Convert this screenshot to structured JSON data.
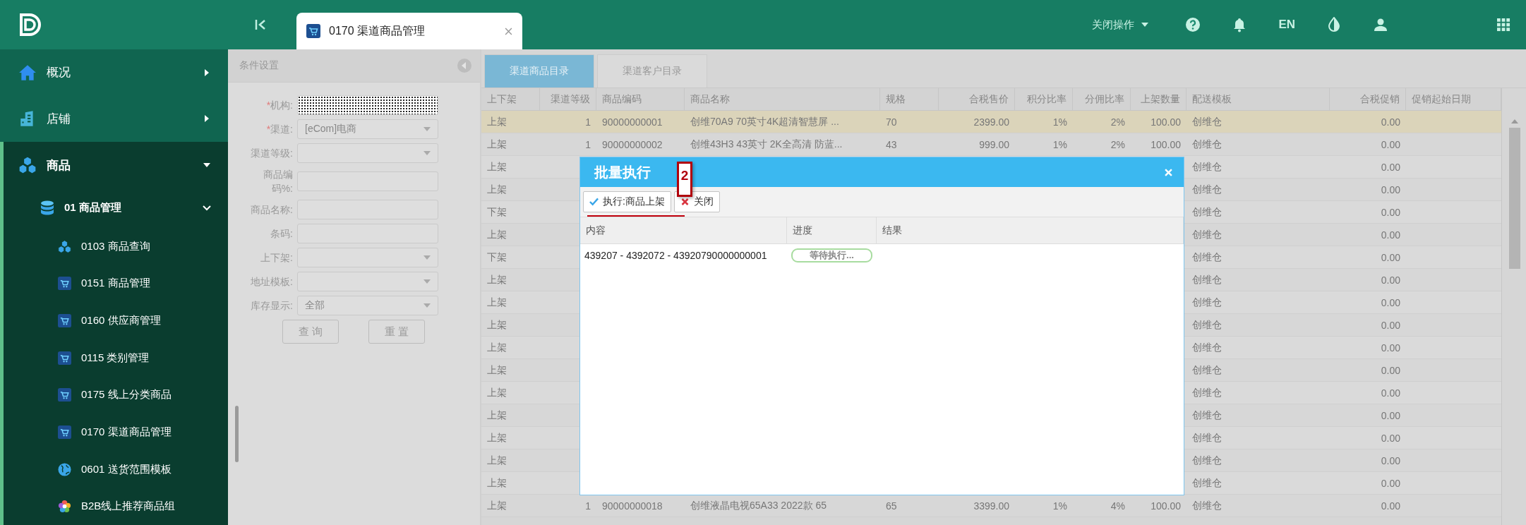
{
  "topbar": {
    "tab": {
      "label": "0170 渠道商品管理",
      "selected": true
    },
    "close_ops": "关闭操作",
    "language": "EN"
  },
  "sidebar": {
    "items": [
      {
        "label": "概况",
        "expanded": false
      },
      {
        "label": "店铺",
        "expanded": false
      },
      {
        "label": "商品",
        "expanded": true,
        "children": [
          {
            "label": "01 商品管理",
            "expanded": true,
            "children": [
              {
                "label": "0103 商品查询"
              },
              {
                "label": "0151 商品管理"
              },
              {
                "label": "0160 供应商管理"
              },
              {
                "label": "0115 类别管理"
              },
              {
                "label": "0175 线上分类商品"
              },
              {
                "label": "0170 渠道商品管理"
              },
              {
                "label": "0601 送货范围模板"
              },
              {
                "label": "B2B线上推荐商品组"
              }
            ]
          }
        ]
      }
    ]
  },
  "filter_panel": {
    "title": "条件设置",
    "fields": [
      {
        "label": "机构:",
        "required_mark": "*",
        "kind": "masked"
      },
      {
        "label": "渠道:",
        "required_mark": "*",
        "kind": "select",
        "value": "[eCom]电商"
      },
      {
        "label": "渠道等级:",
        "kind": "select"
      },
      {
        "label": "商品编码%:",
        "kind": "input"
      },
      {
        "label": "商品名称:",
        "kind": "input"
      },
      {
        "label": "条码:",
        "kind": "input"
      },
      {
        "label": "上下架:",
        "kind": "select"
      },
      {
        "label": "地址模板:",
        "kind": "select"
      },
      {
        "label": "库存显示:",
        "kind": "select",
        "value": "全部"
      }
    ],
    "buttons": [
      "查 询",
      "重 置"
    ]
  },
  "tabs": [
    {
      "label": "渠道商品目录",
      "selected": true
    },
    {
      "label": "渠道客户目录",
      "selected": false
    }
  ],
  "table": {
    "columns": [
      "上下架",
      "渠道等级",
      "商品编码",
      "商品名称",
      "规格",
      "合税售价",
      "积分比率",
      "分佣比率",
      "上架数量",
      "配送模板",
      "合税促销",
      "促销起始日期"
    ],
    "rows": [
      {
        "selected": true,
        "cells": [
          "上架",
          "1",
          "90000000001",
          "创维70A9 70英寸4K超清智慧屏 ...",
          "70",
          "2399.00",
          "1%",
          "2%",
          "100.00",
          "创维仓",
          "0.00"
        ]
      },
      {
        "selected": false,
        "cells": [
          "上架",
          "1",
          "90000000002",
          "创维43H3 43英寸 2K全高清 防蓝...",
          "43",
          "999.00",
          "1%",
          "2%",
          "100.00",
          "创维仓",
          "0.00"
        ]
      },
      {
        "selected": false,
        "cells": [
          "上架",
          null,
          null,
          null,
          null,
          null,
          null,
          null,
          null,
          "创维仓",
          "0.00"
        ]
      },
      {
        "selected": false,
        "cells": [
          "上架",
          null,
          null,
          null,
          null,
          null,
          null,
          null,
          null,
          "创维仓",
          "0.00"
        ]
      },
      {
        "selected": false,
        "cells": [
          "下架",
          null,
          null,
          null,
          null,
          null,
          null,
          null,
          null,
          "创维仓",
          "0.00"
        ]
      },
      {
        "selected": false,
        "cells": [
          "上架",
          null,
          null,
          null,
          null,
          null,
          null,
          null,
          null,
          "创维仓",
          "0.00"
        ]
      },
      {
        "selected": false,
        "cells": [
          "下架",
          null,
          null,
          null,
          null,
          null,
          null,
          null,
          null,
          "创维仓",
          "0.00"
        ]
      },
      {
        "selected": false,
        "cells": [
          "上架",
          null,
          null,
          null,
          null,
          null,
          null,
          null,
          null,
          "创维仓",
          "0.00"
        ]
      },
      {
        "selected": false,
        "cells": [
          "上架",
          null,
          null,
          null,
          null,
          null,
          null,
          null,
          null,
          "创维仓",
          "0.00"
        ]
      },
      {
        "selected": false,
        "cells": [
          "上架",
          null,
          null,
          null,
          null,
          null,
          null,
          null,
          null,
          "创维仓",
          "0.00"
        ]
      },
      {
        "selected": false,
        "cells": [
          "上架",
          null,
          null,
          null,
          null,
          null,
          null,
          null,
          null,
          "创维仓",
          "0.00"
        ]
      },
      {
        "selected": false,
        "cells": [
          "上架",
          null,
          null,
          null,
          null,
          null,
          null,
          null,
          null,
          "创维仓",
          "0.00"
        ]
      },
      {
        "selected": false,
        "cells": [
          "上架",
          null,
          null,
          null,
          null,
          null,
          null,
          null,
          null,
          "创维仓",
          "0.00"
        ]
      },
      {
        "selected": false,
        "cells": [
          "上架",
          null,
          null,
          null,
          null,
          null,
          null,
          null,
          null,
          "创维仓",
          "0.00"
        ]
      },
      {
        "selected": false,
        "cells": [
          "上架",
          null,
          null,
          null,
          null,
          null,
          null,
          null,
          null,
          "创维仓",
          "0.00"
        ]
      },
      {
        "selected": false,
        "cells": [
          "上架",
          null,
          null,
          null,
          null,
          null,
          null,
          null,
          null,
          "创维仓",
          "0.00"
        ]
      },
      {
        "selected": false,
        "cells": [
          "上架",
          null,
          null,
          null,
          null,
          null,
          null,
          null,
          null,
          "创维仓",
          "0.00"
        ]
      },
      {
        "selected": false,
        "cells": [
          "上架",
          "1",
          "90000000018",
          "创维液晶电视65A33 2022款 65",
          "65",
          "3399.00",
          "1%",
          "4%",
          "100.00",
          "创维仓",
          "0.00"
        ]
      }
    ]
  },
  "dialog": {
    "title": "批量执行",
    "buttons": [
      {
        "label": "执行:商品上架",
        "kind": "confirm"
      },
      {
        "label": "关闭",
        "kind": "close"
      }
    ],
    "annotation": "2",
    "columns": [
      "内容",
      "进度",
      "结果"
    ],
    "rows": [
      {
        "content": "439207 - 4392072 - 43920790000000001",
        "progress": {
          "label": "等待执行...",
          "level": 0
        }
      }
    ]
  }
}
